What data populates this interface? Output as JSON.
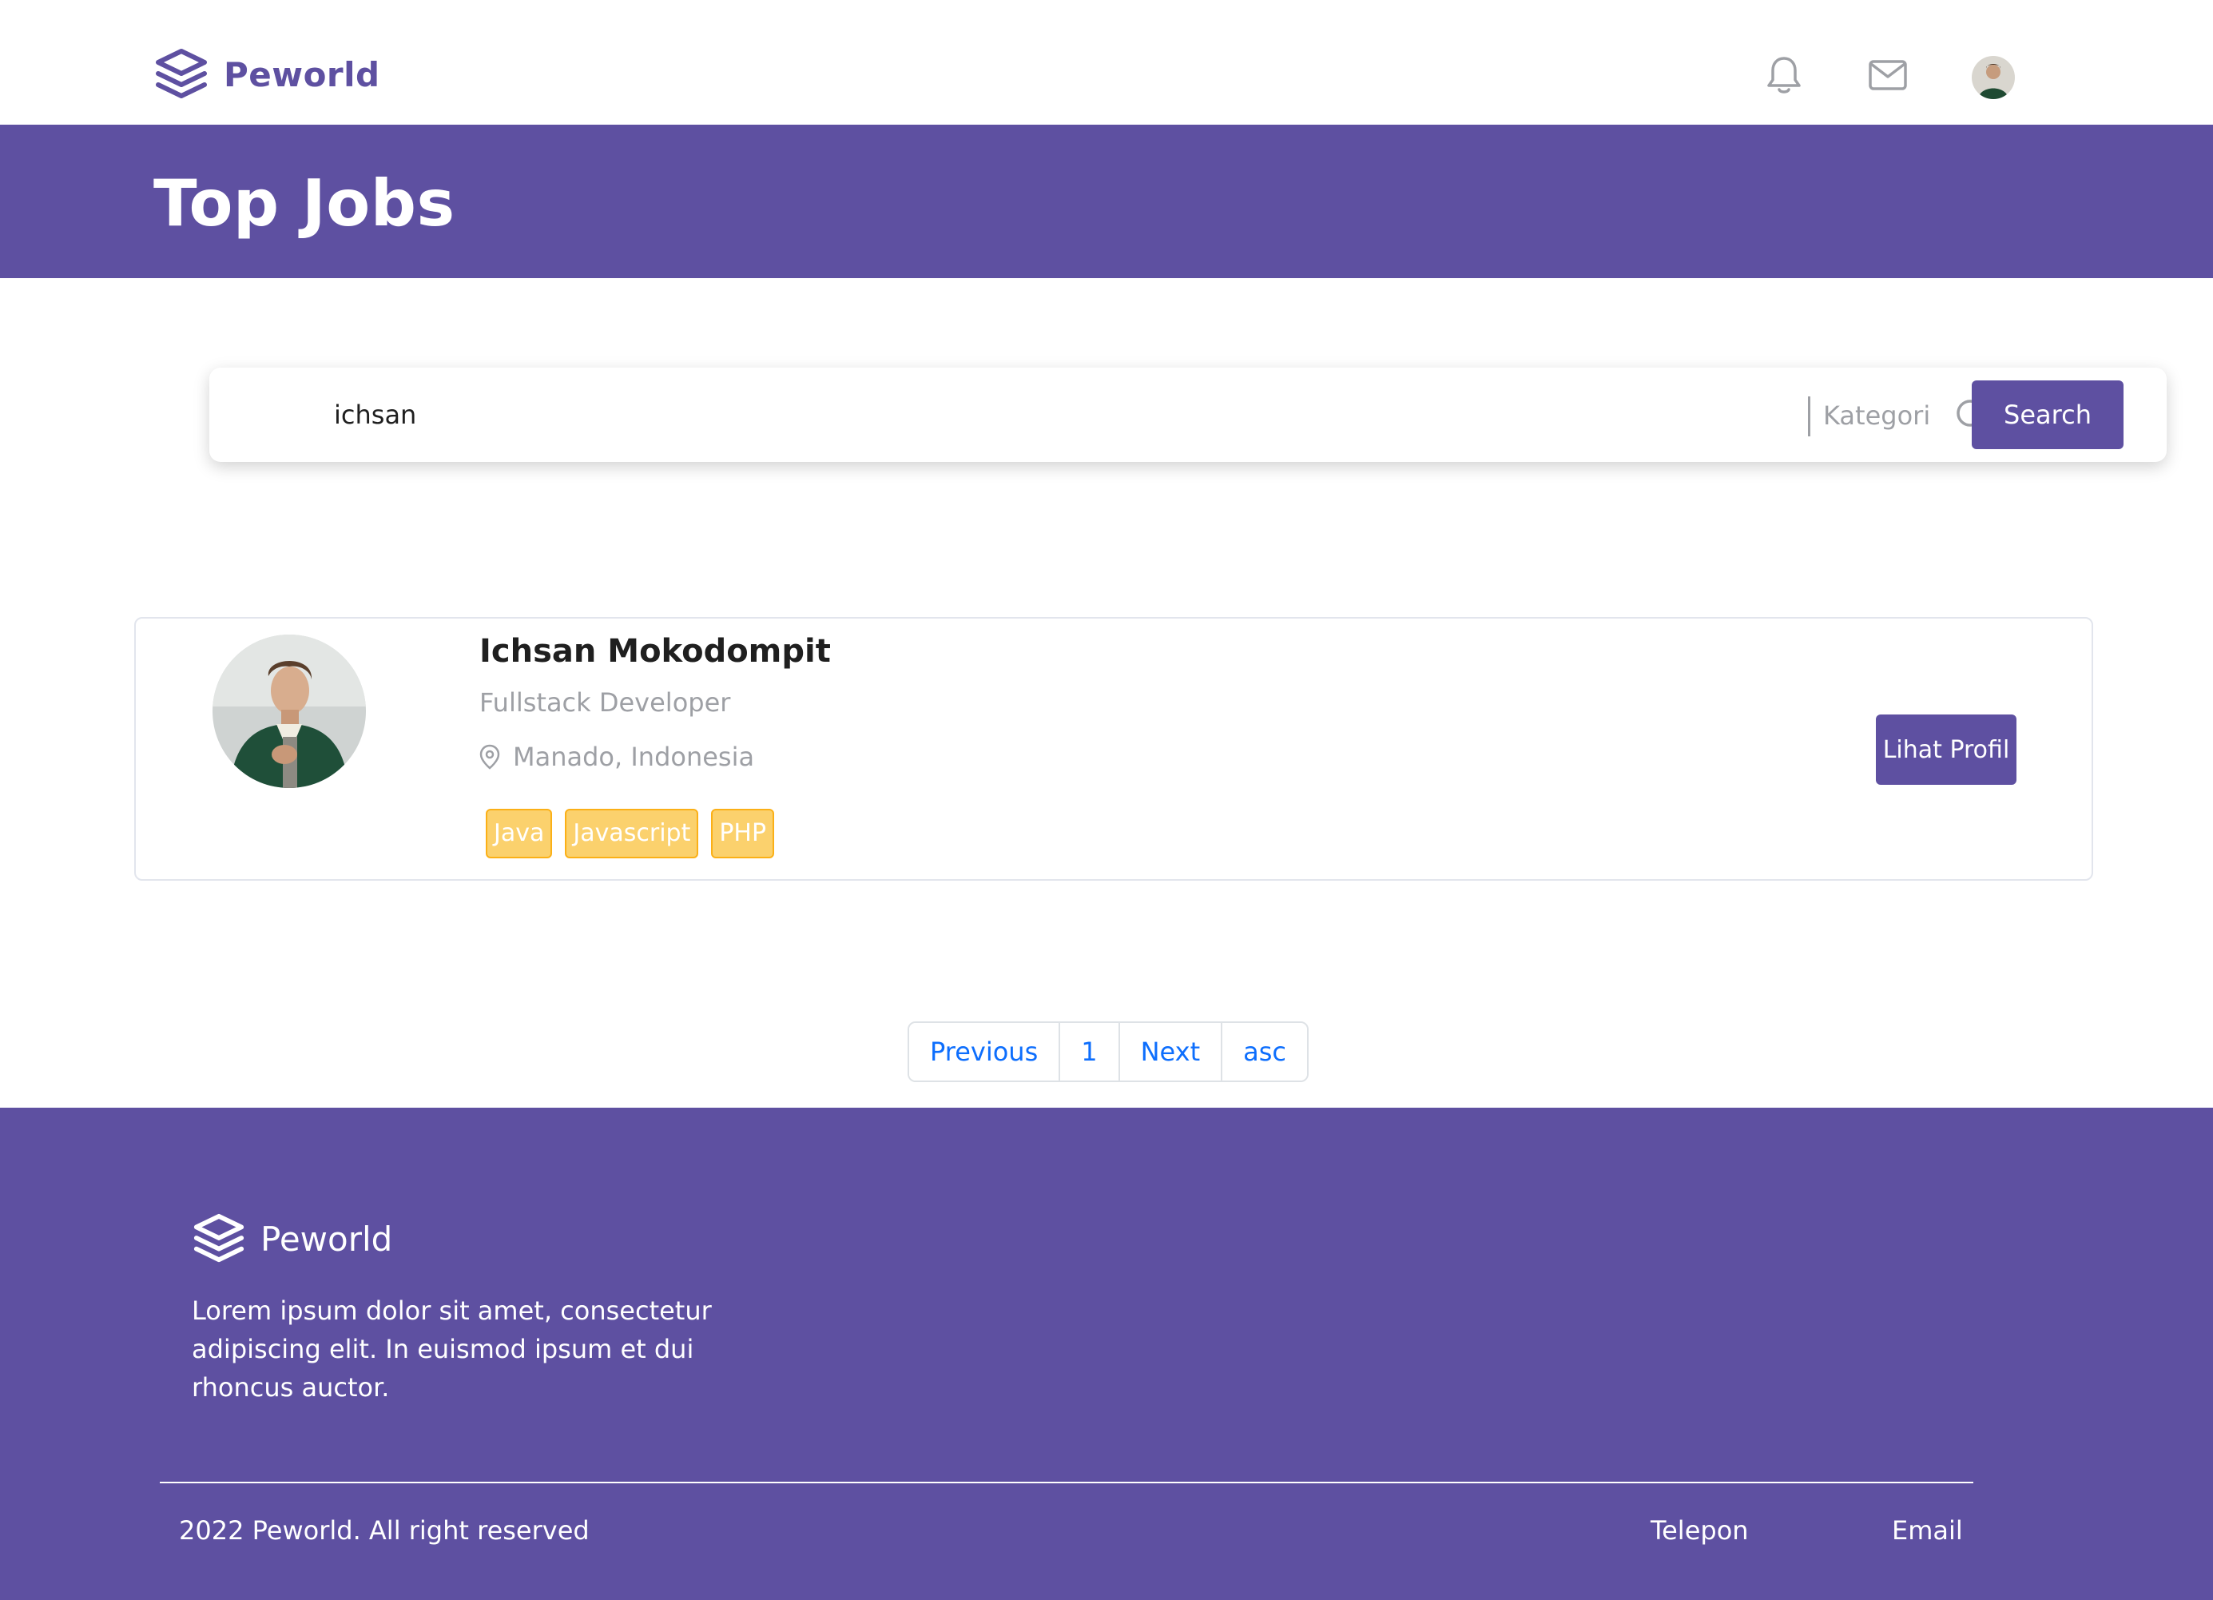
{
  "brand": {
    "name": "Peworld",
    "color": "#5e50a1"
  },
  "navbar": {
    "notification_icon": "bell-icon",
    "message_icon": "mail-icon",
    "avatar_icon": "user-avatar"
  },
  "hero": {
    "title": "Top Jobs"
  },
  "search": {
    "value": "ichsan",
    "icon": "search-icon",
    "category_label": "Kategori",
    "button_label": "Search"
  },
  "results": [
    {
      "name": "Ichsan Mokodompit",
      "role": "Fullstack Developer",
      "location": "Manado, Indonesia",
      "skills": [
        "Java",
        "Javascript",
        "PHP"
      ],
      "action_label": "Lihat Profil"
    }
  ],
  "pagination": {
    "previous": "Previous",
    "page": "1",
    "next": "Next",
    "sort": "asc"
  },
  "footer": {
    "brand_name": "Peworld",
    "description": "Lorem ipsum dolor sit amet, consectetur adipiscing elit. In euismod ipsum et dui rhoncus auctor.",
    "copyright": "2022 Peworld. All right reserved",
    "links": [
      "Telepon",
      "Email"
    ]
  },
  "colors": {
    "primary": "#5e50a1",
    "skill_bg": "#fbd16d",
    "skill_border": "#fbb017",
    "muted_text": "#9ea0a5",
    "link": "#0d6efd"
  }
}
